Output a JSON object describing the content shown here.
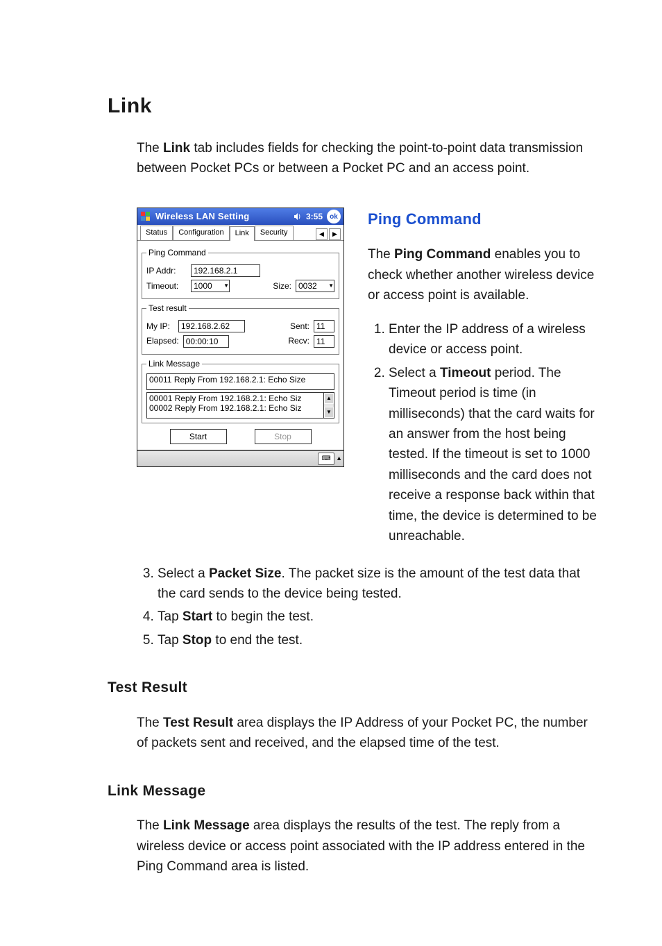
{
  "h1": "Link",
  "intro_1a": "The ",
  "intro_1b": "Link",
  "intro_1c": " tab includes fields for checking the point-to-point data transmission between Pocket PCs or between a Pocket PC and an access point.",
  "screenshot": {
    "title": "Wireless LAN Setting",
    "time": "3:55",
    "ok": "ok",
    "tabs": {
      "status": "Status",
      "config": "Configuration",
      "link": "Link",
      "security": "Security",
      "nav_left": "◀",
      "nav_right": "▶"
    },
    "ping": {
      "legend": "Ping Command",
      "ip_label": "IP Addr:",
      "ip_value": "192.168.2.1",
      "timeout_label": "Timeout:",
      "timeout_value": "1000",
      "size_label": "Size:",
      "size_value": "0032"
    },
    "result": {
      "legend": "Test result",
      "myip_label": "My IP:",
      "myip_value": "192.168.2.62",
      "sent_label": "Sent:",
      "sent_value": "11",
      "elapsed_label": "Elapsed:",
      "elapsed_value": "00:00:10",
      "recv_label": "Recv:",
      "recv_value": "11"
    },
    "msg": {
      "legend": "Link Message",
      "single": "00011 Reply From 192.168.2.1: Echo Size",
      "line1": "00001 Reply From 192.168.2.1: Echo Siz",
      "line2": "00002 Reply From 192.168.2.1: Echo Siz"
    },
    "buttons": {
      "start": "Start",
      "stop": "Stop"
    }
  },
  "right": {
    "h2": "Ping Command",
    "p1a": "The ",
    "p1b": "Ping Command",
    "p1c": " enables you to check whether another wireless device or access point is available.",
    "li1": "Enter the IP address of a wireless device or access point.",
    "li2a": "Select a ",
    "li2b": "Timeout",
    "li2c": " period. The Timeout period is time (in milliseconds) that the card waits for an answer from the host being tested. If the timeout is set to 1000 milliseconds and the card does not receive a response back within that time, the device is determined to be unreachable."
  },
  "li3a": "Select a ",
  "li3b": "Packet Size",
  "li3c": ". The packet size is the amount of the test data that the card sends to the device being tested.",
  "li4a": "Tap ",
  "li4b": "Start",
  "li4c": " to begin the test.",
  "li5a": "Tap ",
  "li5b": "Stop",
  "li5c": " to end the test.",
  "test_result_h": "Test Result",
  "test_result_p_a": "The ",
  "test_result_p_b": "Test Result",
  "test_result_p_c": " area displays the IP Address of your Pocket PC, the number of packets sent and received, and the elapsed time of the test.",
  "link_msg_h": "Link Message",
  "link_msg_p_a": "The ",
  "link_msg_p_b": "Link Message",
  "link_msg_p_c": " area displays the results of the test. The reply from a wireless device or access point associated with the IP address entered in the Ping Command area is listed."
}
